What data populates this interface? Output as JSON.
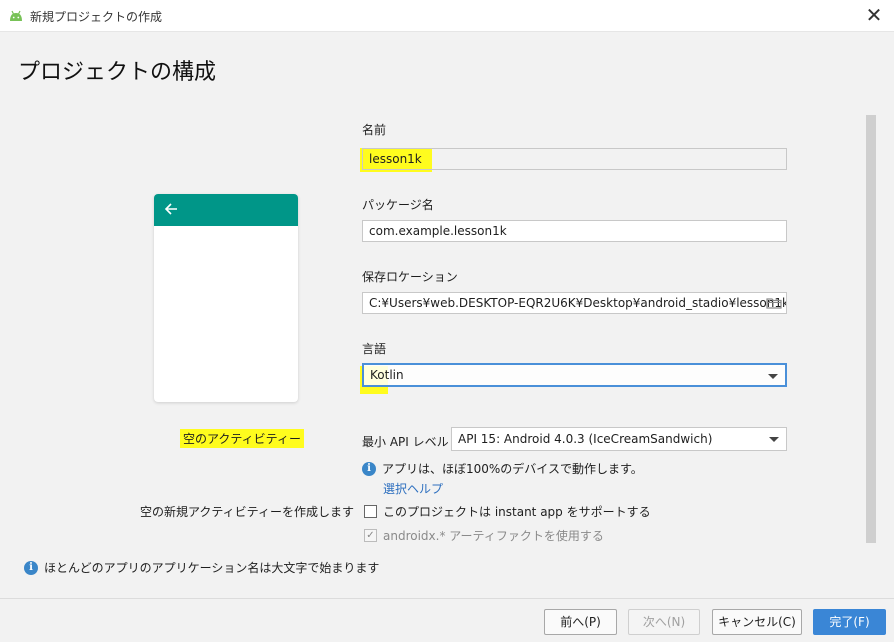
{
  "window": {
    "title": "新規プロジェクトの作成",
    "close_glyph": "✕"
  },
  "header": {
    "title": "プロジェクトの構成"
  },
  "preview": {
    "activity_name": "空のアクティビティー",
    "activity_description": "空の新規アクティビティーを作成します",
    "appbar_color": "#009688"
  },
  "hint": {
    "icon_glyph": "i",
    "text": "ほとんどのアプリのアプリケーション名は大文字で始まります"
  },
  "form": {
    "name": {
      "label": "名前",
      "value": "lesson1k"
    },
    "package": {
      "label": "パッケージ名",
      "value": "com.example.lesson1k"
    },
    "location": {
      "label": "保存ロケーション",
      "value": "C:¥Users¥web.DESKTOP-EQR2U6K¥Desktop¥android_stadio¥lesson1k"
    },
    "language": {
      "label": "言語",
      "value": "Kotlin"
    },
    "min_api": {
      "label": "最小 API レベル",
      "value": "API 15: Android 4.0.3 (IceCreamSandwich)"
    },
    "api_info": {
      "icon_glyph": "i",
      "text": "アプリは、ほぼ100%のデバイスで動作します。",
      "help_link": "選択ヘルプ"
    },
    "instant_app": {
      "label": "このプロジェクトは instant app をサポートする",
      "checked": false
    },
    "androidx": {
      "label": "androidx.* アーティファクトを使用する",
      "checked": true,
      "check_glyph": "✓"
    }
  },
  "footer": {
    "prev_label": "前へ(P)",
    "next_label": "次へ(N)",
    "cancel_label": "キャンセル(C)",
    "finish_label": "完了(F)"
  },
  "colors": {
    "accent": "#3a86d6",
    "highlight": "#fffc1e",
    "link": "#2d6fbf"
  }
}
